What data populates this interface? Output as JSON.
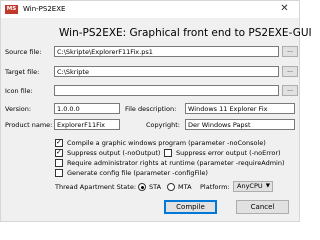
{
  "window": {
    "title": "Win-PS2EXE",
    "app_icon_text": "MS",
    "close_glyph": "✕"
  },
  "heading": "Win-PS2EXE: Graphical front end to PS2EXE-GUI",
  "files": {
    "source_label": "Source file:",
    "source_value": "C:\\Skripte\\ExplorerF11Fix.ps1",
    "target_label": "Target file:",
    "target_value": "C:\\Skripte",
    "icon_label": "Icon file:",
    "icon_value": "",
    "browse_label": "..."
  },
  "meta": {
    "version_label": "Version:",
    "version_value": "1.0.0.0",
    "description_label": "File description:",
    "description_value": "Windows 11 Explorer Fix",
    "product_label": "Product name:",
    "product_value": "ExplorerF11Fix",
    "copyright_label": "Copyright:",
    "copyright_value": "Der Windows Papst"
  },
  "options": {
    "no_console": {
      "label": "Compile a graphic windows program (parameter -noConsole)",
      "checked": true
    },
    "no_output": {
      "label": "Suppress output (-noOutput)",
      "checked": true
    },
    "no_error": {
      "label": "Suppress error output (-noError)",
      "checked": false
    },
    "require_admin": {
      "label": "Require administrator rights at runtime (parameter -requireAdmin)",
      "checked": false
    },
    "config_file": {
      "label": "Generate config file (parameter -configFile)",
      "checked": false
    }
  },
  "threading": {
    "label": "Thread Apartment State:",
    "sta_label": "STA",
    "mta_label": "MTA",
    "selected": "STA",
    "platform_label": "Platform:",
    "platform_value": "AnyCPU",
    "platform_arrow": "▼"
  },
  "actions": {
    "compile_label": "Compile",
    "cancel_label": "Cancel"
  }
}
